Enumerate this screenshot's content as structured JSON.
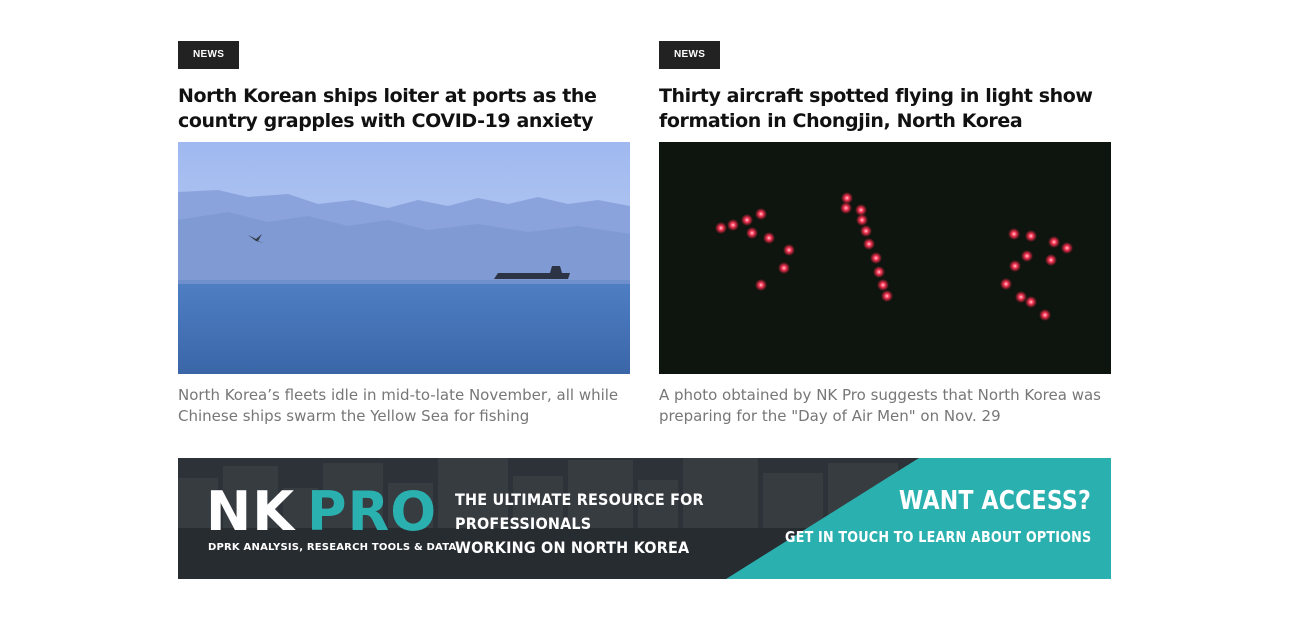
{
  "articles": [
    {
      "badge": "NEWS",
      "headline": "North Korean ships loiter at ports as the country grapples with COVID-19 anxiety",
      "caption": "North Korea’s fleets idle in mid-to-late November, all while Chinese ships swarm the Yellow Sea for fishing"
    },
    {
      "badge": "NEWS",
      "headline": "Thirty aircraft spotted flying in light show formation in Chongjin, North Korea",
      "caption": "A photo obtained by NK Pro suggests that North Korea was preparing for the \"Day of Air Men\" on Nov. 29"
    }
  ],
  "banner": {
    "logo_nk": "NK",
    "logo_pro": "PRO",
    "subtitle": "DPRK ANALYSIS, RESEARCH TOOLS & DATA",
    "tagline": [
      "THE ULTIMATE RESOURCE FOR",
      "PROFESSIONALS",
      "WORKING ON NORTH KOREA"
    ],
    "cta_title": "WANT ACCESS?",
    "cta_sub": "GET IN TOUCH TO LEARN ABOUT OPTIONS",
    "colors": {
      "teal": "#2bb0b0",
      "dark": "#2a2f36"
    }
  },
  "colors": {
    "badge_bg": "#222222",
    "caption": "#777777",
    "headline": "#111111"
  }
}
